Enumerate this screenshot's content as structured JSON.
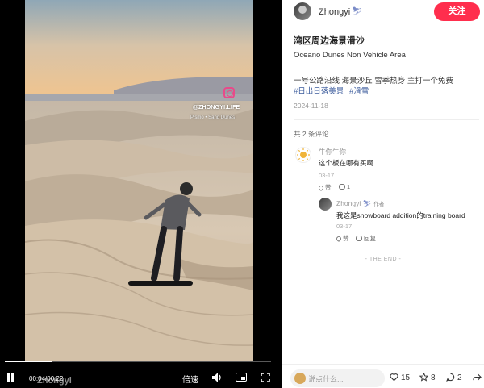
{
  "video": {
    "watermark_handle": "@ZHONGYI.LIFE",
    "watermark_location": "Pismo • Sand Dunes",
    "author_watermark": "Zhongyi",
    "time": "00:04/00:22",
    "progress_fraction": 0.18,
    "speed_label": "倍速"
  },
  "author": {
    "name": "Zhongyi",
    "badge_icon": "skier-emoji",
    "follow_label": "关注",
    "follow_color": "#ff2e4d"
  },
  "note": {
    "title": "湾区周边海景滑沙",
    "subtitle": "Oceano Dunes Non Vehicle Area",
    "description": "一号公路沿线 海景沙丘 雪季热身 主打一个免费",
    "tags": [
      "#日出日落美景",
      "#滑雪"
    ],
    "date": "2024-11-18"
  },
  "comments": {
    "count_label": "共 2 条评论",
    "items": [
      {
        "name": "牛你牛你",
        "text": "这个板在哪有买啊",
        "date": "03-17",
        "like_label": "赞",
        "reply_count": "1"
      },
      {
        "name": "Zhongyi",
        "author_tag": "作者",
        "text": "我这是snowboard addition的training board",
        "date": "03-17",
        "like_label": "赞",
        "reply_label": "回复"
      }
    ],
    "end_label": "- THE END -"
  },
  "bottom_bar": {
    "comment_placeholder": "说点什么...",
    "likes": "15",
    "collects": "8",
    "comments": "2"
  }
}
